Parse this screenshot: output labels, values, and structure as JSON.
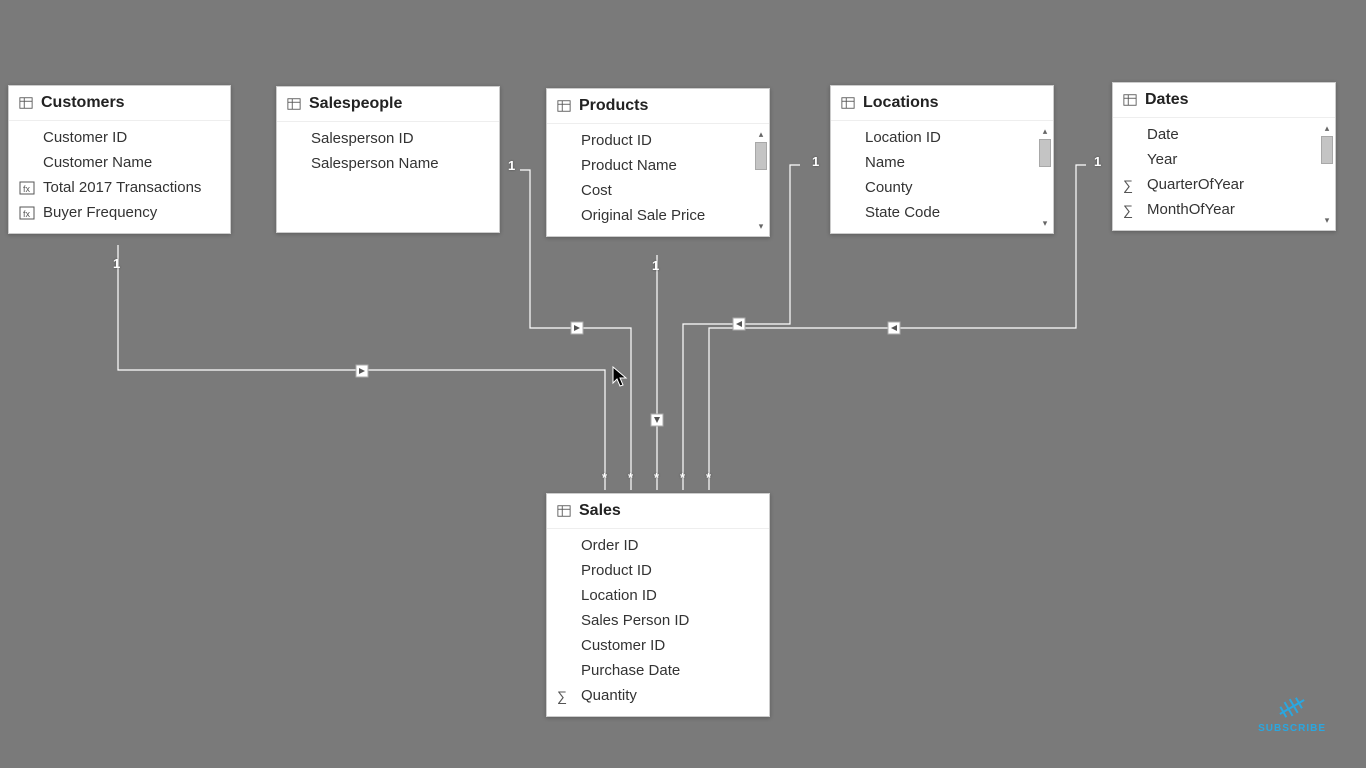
{
  "cardinality": {
    "one": "1",
    "many": "*"
  },
  "tables": {
    "customers": {
      "title": "Customers",
      "fields": [
        {
          "label": "Customer ID",
          "icon": null
        },
        {
          "label": "Customer Name",
          "icon": null
        },
        {
          "label": "Total 2017 Transactions",
          "icon": "fx"
        },
        {
          "label": "Buyer Frequency",
          "icon": "fx"
        }
      ]
    },
    "salespeople": {
      "title": "Salespeople",
      "fields": [
        {
          "label": "Salesperson ID",
          "icon": null
        },
        {
          "label": "Salesperson Name",
          "icon": null
        }
      ]
    },
    "products": {
      "title": "Products",
      "fields": [
        {
          "label": "Product ID",
          "icon": null
        },
        {
          "label": "Product Name",
          "icon": null
        },
        {
          "label": "Cost",
          "icon": null
        },
        {
          "label": "Original Sale Price",
          "icon": null
        }
      ]
    },
    "locations": {
      "title": "Locations",
      "fields": [
        {
          "label": "Location ID",
          "icon": null
        },
        {
          "label": "Name",
          "icon": null
        },
        {
          "label": "County",
          "icon": null
        },
        {
          "label": "State Code",
          "icon": null
        }
      ]
    },
    "dates": {
      "title": "Dates",
      "fields": [
        {
          "label": "Date",
          "icon": null
        },
        {
          "label": "Year",
          "icon": null
        },
        {
          "label": "QuarterOfYear",
          "icon": "sigma"
        },
        {
          "label": "MonthOfYear",
          "icon": "sigma"
        }
      ]
    },
    "sales": {
      "title": "Sales",
      "fields": [
        {
          "label": "Order ID",
          "icon": null
        },
        {
          "label": "Product ID",
          "icon": null
        },
        {
          "label": "Location ID",
          "icon": null
        },
        {
          "label": "Sales Person ID",
          "icon": null
        },
        {
          "label": "Customer ID",
          "icon": null
        },
        {
          "label": "Purchase Date",
          "icon": null
        },
        {
          "label": "Quantity",
          "icon": "sigma"
        }
      ]
    }
  },
  "subscribe_label": "SUBSCRIBE"
}
